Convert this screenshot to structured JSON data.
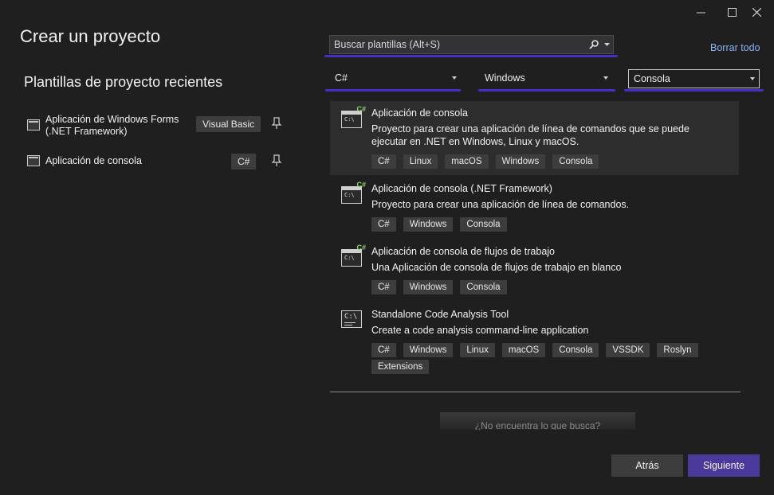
{
  "window": {
    "title": "Crear un proyecto",
    "minimize_icon": "minimize-icon",
    "maximize_icon": "maximize-icon",
    "close_icon": "close-icon"
  },
  "recent": {
    "title": "Plantillas de proyecto recientes",
    "items": [
      {
        "name": "Aplicación de Windows Forms (.NET Framework)",
        "language": "Visual Basic"
      },
      {
        "name": "Aplicación de consola",
        "language": "C#"
      }
    ]
  },
  "search": {
    "placeholder": "Buscar plantillas (Alt+S)",
    "clear_all": "Borrar todo"
  },
  "filters": {
    "language": "C#",
    "platform": "Windows",
    "project_type": "Consola"
  },
  "templates": [
    {
      "name": "Aplicación de consola",
      "description": "Proyecto para crear una aplicación de línea de comandos que se puede ejecutar en .NET en Windows, Linux y macOS.",
      "tags": [
        "C#",
        "Linux",
        "macOS",
        "Windows",
        "Consola"
      ]
    },
    {
      "name": "Aplicación de consola (.NET Framework)",
      "description": "Proyecto para crear una aplicación de línea de comandos.",
      "tags": [
        "C#",
        "Windows",
        "Consola"
      ]
    },
    {
      "name": "Aplicación de consola de flujos de trabajo",
      "description": "Una Aplicación de consola de flujos de trabajo en blanco",
      "tags": [
        "C#",
        "Windows",
        "Consola"
      ]
    },
    {
      "name": "Standalone Code Analysis Tool",
      "description": "Create a code analysis command-line application",
      "tags": [
        "C#",
        "Windows",
        "Linux",
        "macOS",
        "Consola",
        "VSSDK",
        "Roslyn",
        "Extensions"
      ]
    }
  ],
  "not_found": "¿No encuentra lo que busca?",
  "buttons": {
    "back": "Atrás",
    "next": "Siguiente"
  },
  "colors": {
    "accent": "#4b2cc7",
    "next_button": "#4b3a9c",
    "link": "#8ab4f8",
    "background": "#1f1f1f"
  }
}
